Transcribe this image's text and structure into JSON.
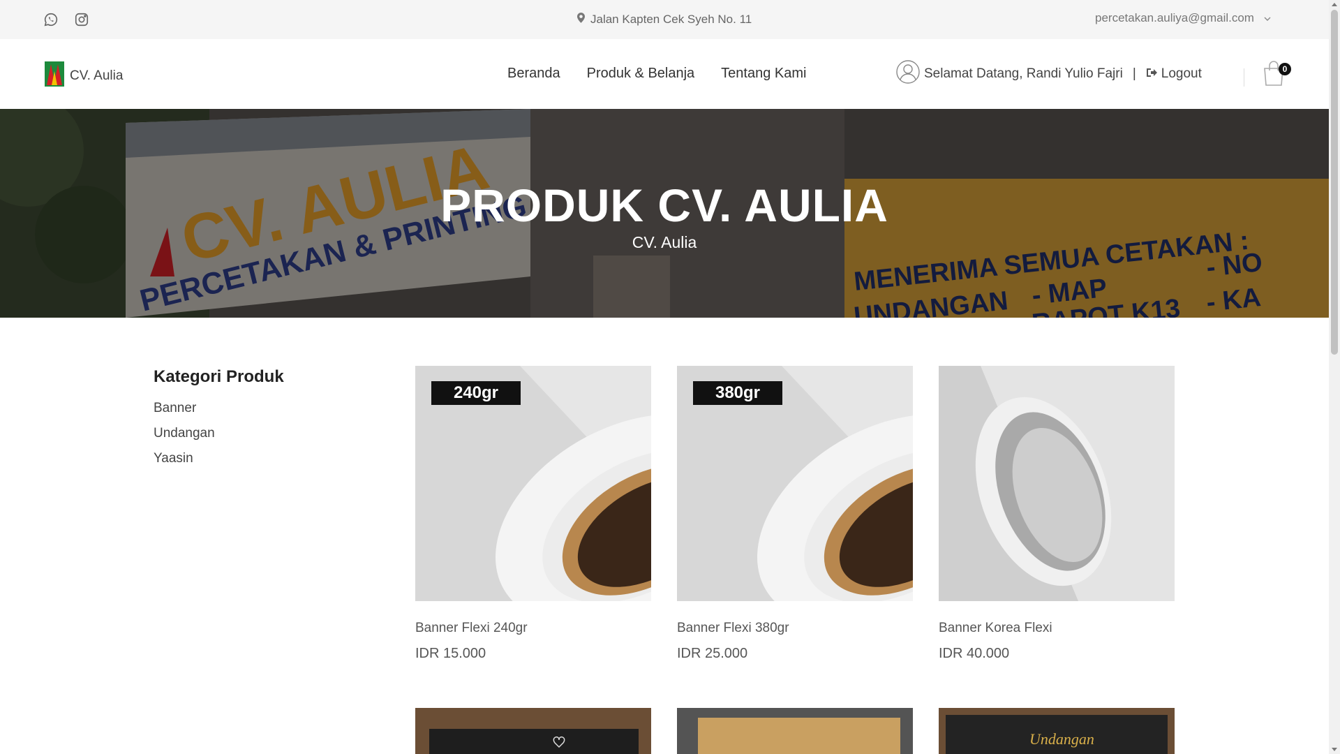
{
  "topbar": {
    "address": "Jalan Kapten Cek Syeh No. 11",
    "email": "percetakan.auliya@gmail.com",
    "icons": [
      "whatsapp-icon",
      "instagram-icon",
      "map-pin-icon",
      "chevron-down-icon"
    ]
  },
  "header": {
    "brand": "CV. Aulia",
    "nav": [
      "Beranda",
      "Produk & Belanja",
      "Tentang Kami"
    ],
    "welcome": "Selamat Datang, Randi Yulio Fajri",
    "separator": "|",
    "logout": "Logout",
    "cart_count": "0"
  },
  "hero": {
    "title": "PRODUK CV. AULIA",
    "subtitle": "CV. Aulia",
    "background_sign": [
      "CV. AULIA",
      "PERCETAKAN & PRINTING",
      "MENERIMA SEMUA CETAKAN :",
      "UNDANGAN",
      "- MAP",
      "RAPOT K13",
      "- NO",
      "- KA"
    ]
  },
  "sidebar": {
    "title": "Kategori Produk",
    "categories": [
      "Banner",
      "Undangan",
      "Yaasin"
    ]
  },
  "products": [
    {
      "name": "Banner Flexi 240gr",
      "price": "IDR 15.000",
      "tag": "240gr"
    },
    {
      "name": "Banner Flexi 380gr",
      "price": "IDR 25.000",
      "tag": "380gr"
    },
    {
      "name": "Banner Korea Flexi",
      "price": "IDR 40.000",
      "tag": ""
    }
  ],
  "partial_products": [
    {
      "label": ""
    },
    {
      "label": ""
    },
    {
      "label": "Undangan"
    }
  ],
  "colors": {
    "topbar_bg": "#f5f5f5",
    "brand_red": "#d32027",
    "brand_green": "#1d8a3c",
    "sign_yellow": "#e8a02a"
  }
}
